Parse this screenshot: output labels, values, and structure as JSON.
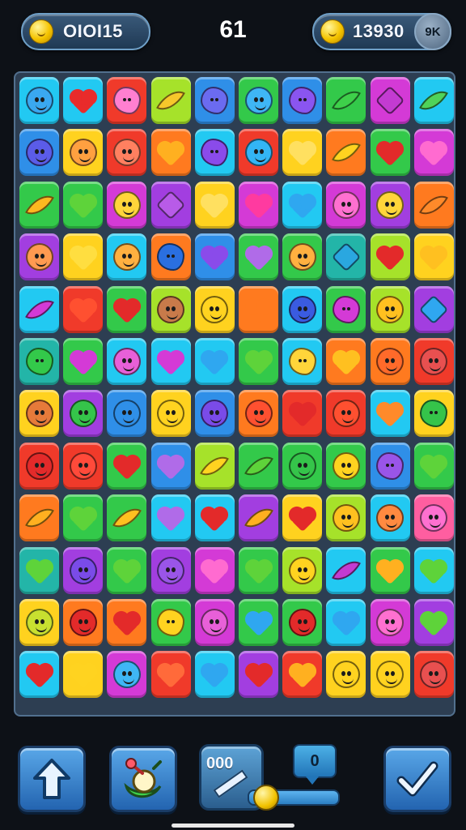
{
  "hud": {
    "left_value": "OIOI15",
    "moves": "61",
    "right_value": "13930",
    "right_badge": "9K"
  },
  "controls": {
    "panel_value": "000",
    "bubble_value": "0",
    "slider_level": 0.08
  },
  "board": {
    "cols": 10,
    "rows": 12,
    "colors": {
      "cyan": "#22c9f2",
      "red": "#f03a2a",
      "lime": "#a6e22a",
      "green": "#33c94a",
      "blue": "#2f8fe8",
      "purple": "#a23ee0",
      "magenta": "#d43ad6",
      "yellow": "#ffd21f",
      "orange": "#ff7a1f",
      "pink": "#ff5ea0",
      "teal": "#23b5a8"
    },
    "tiles": [
      [
        [
          "cyan",
          "face",
          "#3aa8f0"
        ],
        [
          "cyan",
          "heart",
          "#e92b2b"
        ],
        [
          "red",
          "blob",
          "#ff7fd0"
        ],
        [
          "lime",
          "leaf",
          "#f7c72b"
        ],
        [
          "blue",
          "blob",
          "#6b6bf0"
        ],
        [
          "green",
          "face",
          "#3fb6f5"
        ],
        [
          "blue",
          "blob",
          "#8a55f0"
        ],
        [
          "green",
          "leaf",
          "#3ed04a"
        ],
        [
          "magenta",
          "gem",
          "#c33bd1"
        ],
        [
          "cyan",
          "leaf",
          "#4fd35a"
        ]
      ],
      [
        [
          "blue",
          "face",
          "#5b5ce8"
        ],
        [
          "yellow",
          "face",
          "#ffa040"
        ],
        [
          "red",
          "face",
          "#ff8060"
        ],
        [
          "orange",
          "heart",
          "#ffb020"
        ],
        [
          "cyan",
          "blob",
          "#8a4bea"
        ],
        [
          "red",
          "face",
          "#33b5f5"
        ],
        [
          "yellow",
          "heart",
          "#ffe060"
        ],
        [
          "orange",
          "leaf",
          "#ffd320"
        ],
        [
          "green",
          "heart",
          "#e32a2a"
        ],
        [
          "magenta",
          "heart",
          "#ff6bd0"
        ]
      ],
      [
        [
          "green",
          "leaf",
          "#ffb820"
        ],
        [
          "green",
          "heart",
          "#5ed33a"
        ],
        [
          "magenta",
          "face",
          "#ffd53a"
        ],
        [
          "purple",
          "gem",
          "#b85be8"
        ],
        [
          "yellow",
          "heart",
          "#ffe060"
        ],
        [
          "magenta",
          "heart",
          "#ff3aa0"
        ],
        [
          "cyan",
          "heart",
          "#2fa7f0"
        ],
        [
          "magenta",
          "face",
          "#ff70d0"
        ],
        [
          "purple",
          "face",
          "#ffd53a"
        ],
        [
          "orange",
          "leaf",
          "#ff8a2a"
        ]
      ],
      [
        [
          "purple",
          "face",
          "#ff9a50"
        ],
        [
          "yellow",
          "heart",
          "#ffde40"
        ],
        [
          "cyan",
          "face",
          "#ffb040"
        ],
        [
          "orange",
          "blob",
          "#2a6fe0"
        ],
        [
          "blue",
          "heart",
          "#8a4bea"
        ],
        [
          "green",
          "heart",
          "#b06be8"
        ],
        [
          "green",
          "face",
          "#ffb040"
        ],
        [
          "teal",
          "gem",
          "#2aa7e0"
        ],
        [
          "lime",
          "heart",
          "#e32a2a"
        ],
        [
          "yellow",
          "heart",
          "#ffc020"
        ]
      ],
      [
        [
          "cyan",
          "leaf",
          "#d43ad6"
        ],
        [
          "red",
          "heart",
          "#ff5030"
        ],
        [
          "green",
          "heart",
          "#e32a2a"
        ],
        [
          "lime",
          "face",
          "#c87a4a"
        ],
        [
          "yellow",
          "face",
          "#ffd320"
        ],
        [
          "orange",
          "heart",
          "#ff7a1f"
        ],
        [
          "cyan",
          "face",
          "#3a5be0"
        ],
        [
          "green",
          "blob",
          "#d43ad6"
        ],
        [
          "lime",
          "face",
          "#ffc020"
        ],
        [
          "purple",
          "gem",
          "#2fa7f0"
        ]
      ],
      [
        [
          "teal",
          "blob",
          "#33c94a"
        ],
        [
          "green",
          "heart",
          "#d43ad6"
        ],
        [
          "cyan",
          "face",
          "#e860d8"
        ],
        [
          "cyan",
          "heart",
          "#d43ad6"
        ],
        [
          "cyan",
          "heart",
          "#2fa7f0"
        ],
        [
          "green",
          "heart",
          "#5ed33a"
        ],
        [
          "cyan",
          "blob",
          "#ffd53a"
        ],
        [
          "orange",
          "heart",
          "#ffc020"
        ],
        [
          "orange",
          "face",
          "#ff6a2a"
        ],
        [
          "red",
          "face",
          "#e85050"
        ]
      ],
      [
        [
          "yellow",
          "face",
          "#e67a3a"
        ],
        [
          "purple",
          "face",
          "#35c44a"
        ],
        [
          "blue",
          "face",
          "#2f8fe8"
        ],
        [
          "yellow",
          "face",
          "#ffd320"
        ],
        [
          "blue",
          "face",
          "#7a4be8"
        ],
        [
          "orange",
          "face",
          "#ff5030"
        ],
        [
          "red",
          "heart",
          "#e32a2a"
        ],
        [
          "red",
          "face",
          "#ff5030"
        ],
        [
          "cyan",
          "heart",
          "#ff8a2a"
        ],
        [
          "yellow",
          "blob",
          "#35c44a"
        ]
      ],
      [
        [
          "red",
          "face",
          "#e32a2a"
        ],
        [
          "red",
          "face",
          "#ff4a3a"
        ],
        [
          "green",
          "heart",
          "#e32a2a"
        ],
        [
          "blue",
          "heart",
          "#b06be8"
        ],
        [
          "lime",
          "leaf",
          "#ffd320"
        ],
        [
          "green",
          "leaf",
          "#5ed33a"
        ],
        [
          "green",
          "face",
          "#35c44a"
        ],
        [
          "green",
          "face",
          "#ffd320"
        ],
        [
          "blue",
          "blob",
          "#9a55e8"
        ],
        [
          "green",
          "heart",
          "#5ed33a"
        ]
      ],
      [
        [
          "orange",
          "leaf",
          "#ffb020"
        ],
        [
          "green",
          "heart",
          "#5ed33a"
        ],
        [
          "green",
          "leaf",
          "#ffc020"
        ],
        [
          "cyan",
          "heart",
          "#b06be8"
        ],
        [
          "cyan",
          "heart",
          "#e32a2a"
        ],
        [
          "purple",
          "leaf",
          "#ffb020"
        ],
        [
          "yellow",
          "heart",
          "#e32a2a"
        ],
        [
          "lime",
          "face",
          "#ffc020"
        ],
        [
          "cyan",
          "face",
          "#ff8a40"
        ],
        [
          "pink",
          "face",
          "#ff70d0"
        ]
      ],
      [
        [
          "teal",
          "heart",
          "#5ed33a"
        ],
        [
          "purple",
          "face",
          "#7a4be8"
        ],
        [
          "green",
          "heart",
          "#5ed33a"
        ],
        [
          "purple",
          "face",
          "#9a55e8"
        ],
        [
          "magenta",
          "heart",
          "#ff6bd0"
        ],
        [
          "green",
          "heart",
          "#5ed33a"
        ],
        [
          "lime",
          "face",
          "#ffd320"
        ],
        [
          "cyan",
          "leaf",
          "#c33bd1"
        ],
        [
          "green",
          "heart",
          "#ffb020"
        ],
        [
          "cyan",
          "heart",
          "#5ed33a"
        ]
      ],
      [
        [
          "yellow",
          "face",
          "#c8e030"
        ],
        [
          "orange",
          "face",
          "#e32a2a"
        ],
        [
          "orange",
          "heart",
          "#e32a2a"
        ],
        [
          "green",
          "blob",
          "#ffd320"
        ],
        [
          "magenta",
          "face",
          "#e860d8"
        ],
        [
          "green",
          "heart",
          "#2fa7f0"
        ],
        [
          "green",
          "face",
          "#e32a2a"
        ],
        [
          "cyan",
          "heart",
          "#2fa7f0"
        ],
        [
          "magenta",
          "face",
          "#ff70d0"
        ],
        [
          "purple",
          "heart",
          "#5ed33a"
        ]
      ],
      [
        [
          "cyan",
          "heart",
          "#e32a2a"
        ],
        [
          "yellow",
          "heart",
          "#ffd320"
        ],
        [
          "magenta",
          "face",
          "#3fb6f5"
        ],
        [
          "red",
          "heart",
          "#ff6a3a"
        ],
        [
          "cyan",
          "heart",
          "#2fa7f0"
        ],
        [
          "purple",
          "heart",
          "#e32a2a"
        ],
        [
          "red",
          "heart",
          "#ffb020"
        ],
        [
          "yellow",
          "face",
          "#ffd320"
        ],
        [
          "yellow",
          "face",
          "#ffd320"
        ],
        [
          "red",
          "face",
          "#e85050"
        ]
      ]
    ]
  }
}
